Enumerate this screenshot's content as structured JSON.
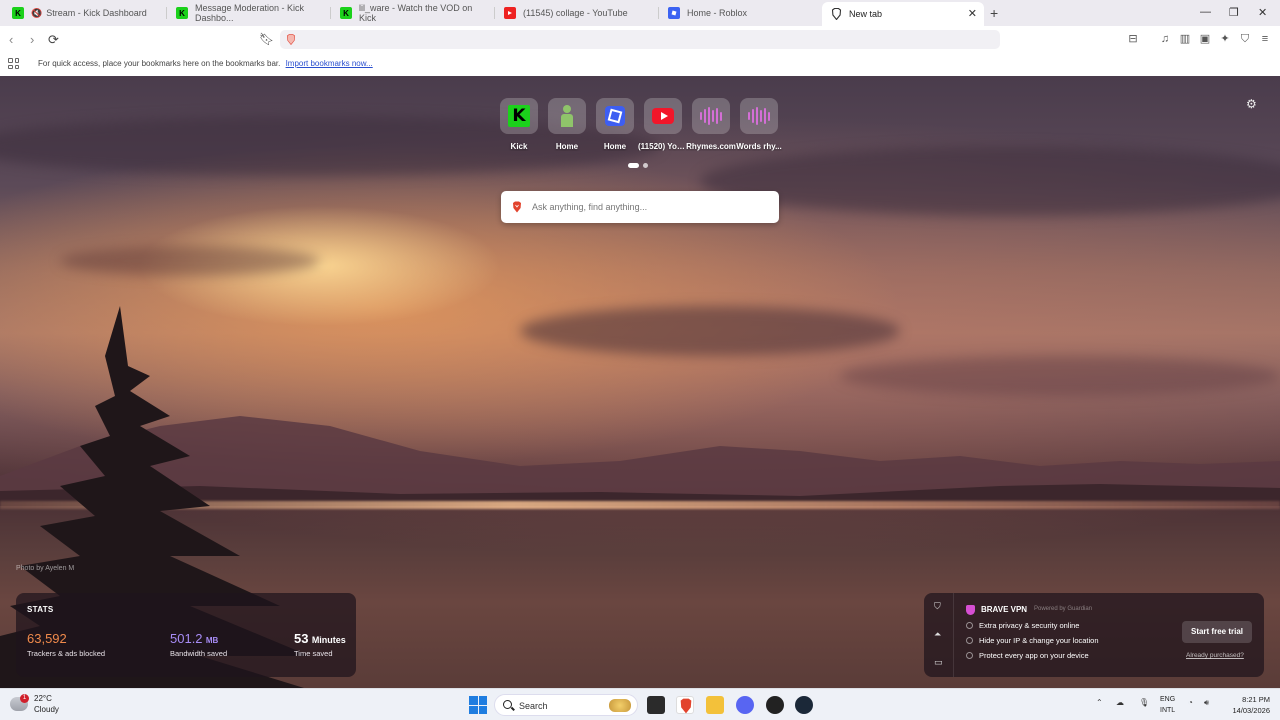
{
  "tabs": [
    {
      "title": "Stream - Kick Dashboard",
      "icon": "kick-icon",
      "muted": true
    },
    {
      "title": "Message Moderation - Kick Dashbo...",
      "icon": "kick-icon"
    },
    {
      "title": "lil_ware - Watch the VOD on Kick",
      "icon": "kick-icon"
    },
    {
      "title": "(11545) collage - YouTube",
      "icon": "youtube-icon"
    },
    {
      "title": "Home - Roblox",
      "icon": "roblox-icon"
    },
    {
      "title": "New tab",
      "icon": "brave-icon",
      "active": true
    }
  ],
  "bookmarks_bar": {
    "message": "For quick access, place your bookmarks here on the bookmarks bar.",
    "link": "Import bookmarks now..."
  },
  "top_sites": [
    {
      "label": "Kick",
      "icon": "kick-icon"
    },
    {
      "label": "Home",
      "icon": "person-icon"
    },
    {
      "label": "Home",
      "icon": "roblox-icon"
    },
    {
      "label": "(11520) You...",
      "icon": "youtube-icon"
    },
    {
      "label": "Rhymes.com",
      "icon": "waveform-icon"
    },
    {
      "label": "Words rhy...",
      "icon": "waveform-icon"
    }
  ],
  "search": {
    "placeholder": "Ask anything, find anything..."
  },
  "photo_credit": "Photo by Ayelen M",
  "stats": {
    "title": "STATS",
    "trackers": {
      "value": "63,592",
      "caption": "Trackers & ads blocked",
      "color": "#f08a4b"
    },
    "bandwidth": {
      "value": "501.2",
      "unit": "MB",
      "caption": "Bandwidth saved",
      "color": "#a78cf5"
    },
    "time": {
      "value": "53",
      "unit": "Minutes",
      "caption": "Time saved",
      "color": "#ffffff"
    }
  },
  "vpn": {
    "brand": "BRAVE VPN",
    "powered": "Powered by Guardian",
    "features": [
      "Extra privacy & security online",
      "Hide your IP & change your location",
      "Protect every app on your device"
    ],
    "cta": "Start free trial",
    "already": "Already purchased?"
  },
  "taskbar": {
    "weather": {
      "temp": "22°C",
      "condition": "Cloudy",
      "badge": "1"
    },
    "search_label": "Search",
    "lang": {
      "line1": "ENG",
      "line2": "INTL"
    },
    "clock": {
      "time": "8:21 PM",
      "date": "14/03/2026"
    }
  }
}
